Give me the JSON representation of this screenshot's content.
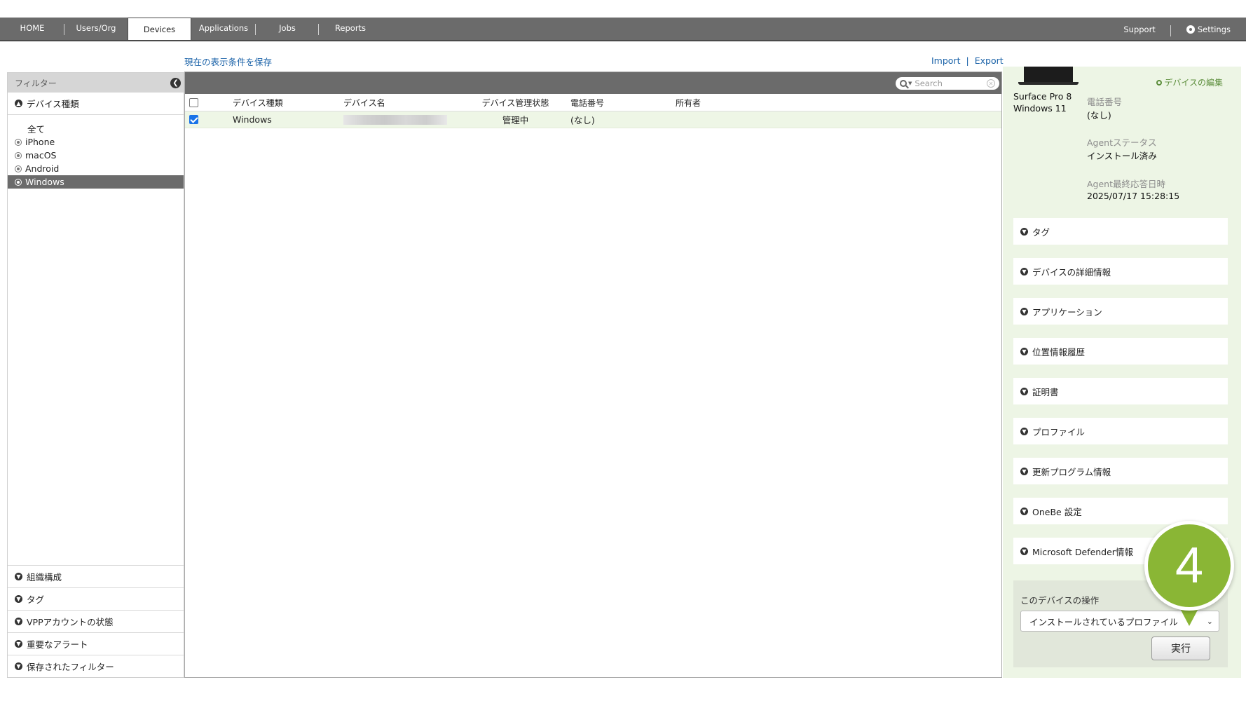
{
  "nav": {
    "tabs": [
      "HOME",
      "Users/Org",
      "Devices",
      "Applications",
      "Jobs",
      "Reports"
    ],
    "active_tab": "Devices",
    "support": "Support",
    "settings": "Settings"
  },
  "toolbar": {
    "save_view": "現在の表示条件を保存",
    "import": "Import",
    "separator": "|",
    "export": "Export"
  },
  "filter": {
    "title": "フィルター",
    "device_type_section": "デバイス種類",
    "items": [
      "全て",
      "iPhone",
      "macOS",
      "Android",
      "Windows"
    ],
    "selected_item": "Windows",
    "bottom_sections": [
      "組織構成",
      "タグ",
      "VPPアカウントの状態",
      "重要なアラート",
      "保存されたフィルター"
    ]
  },
  "grid": {
    "search_placeholder": "Search",
    "columns": [
      "デバイス種類",
      "デバイス名",
      "デバイス管理状態",
      "電話番号",
      "所有者"
    ],
    "rows": [
      {
        "checked": true,
        "type": "Windows",
        "name": "",
        "status": "管理中",
        "phone": "(なし)",
        "owner": ""
      }
    ]
  },
  "detail": {
    "model": "Surface Pro 8",
    "os": "Windows 11",
    "edit_link": "デバイスの編集",
    "phone_label": "電話番号",
    "phone_value": "(なし)",
    "agent_status_label": "Agentステータス",
    "agent_status_value": "インストール済み",
    "agent_last_label": "Agent最終応答日時",
    "agent_last_value": "2025/07/17 15:28:15",
    "sections": [
      "タグ",
      "デバイスの詳細情報",
      "アプリケーション",
      "位置情報履歴",
      "証明書",
      "プロファイル",
      "更新プログラム情報",
      "OneBe 設定",
      "Microsoft Defender情報"
    ],
    "operation": {
      "title": "このデバイスの操作",
      "selected": "インストールされているプロファイル",
      "run": "実行"
    }
  },
  "step_badge": "4",
  "colors": {
    "nav_bg": "#6b6b6b",
    "link": "#1a62a8",
    "detail_bg": "#edf5e5",
    "badge": "#8ab635"
  }
}
